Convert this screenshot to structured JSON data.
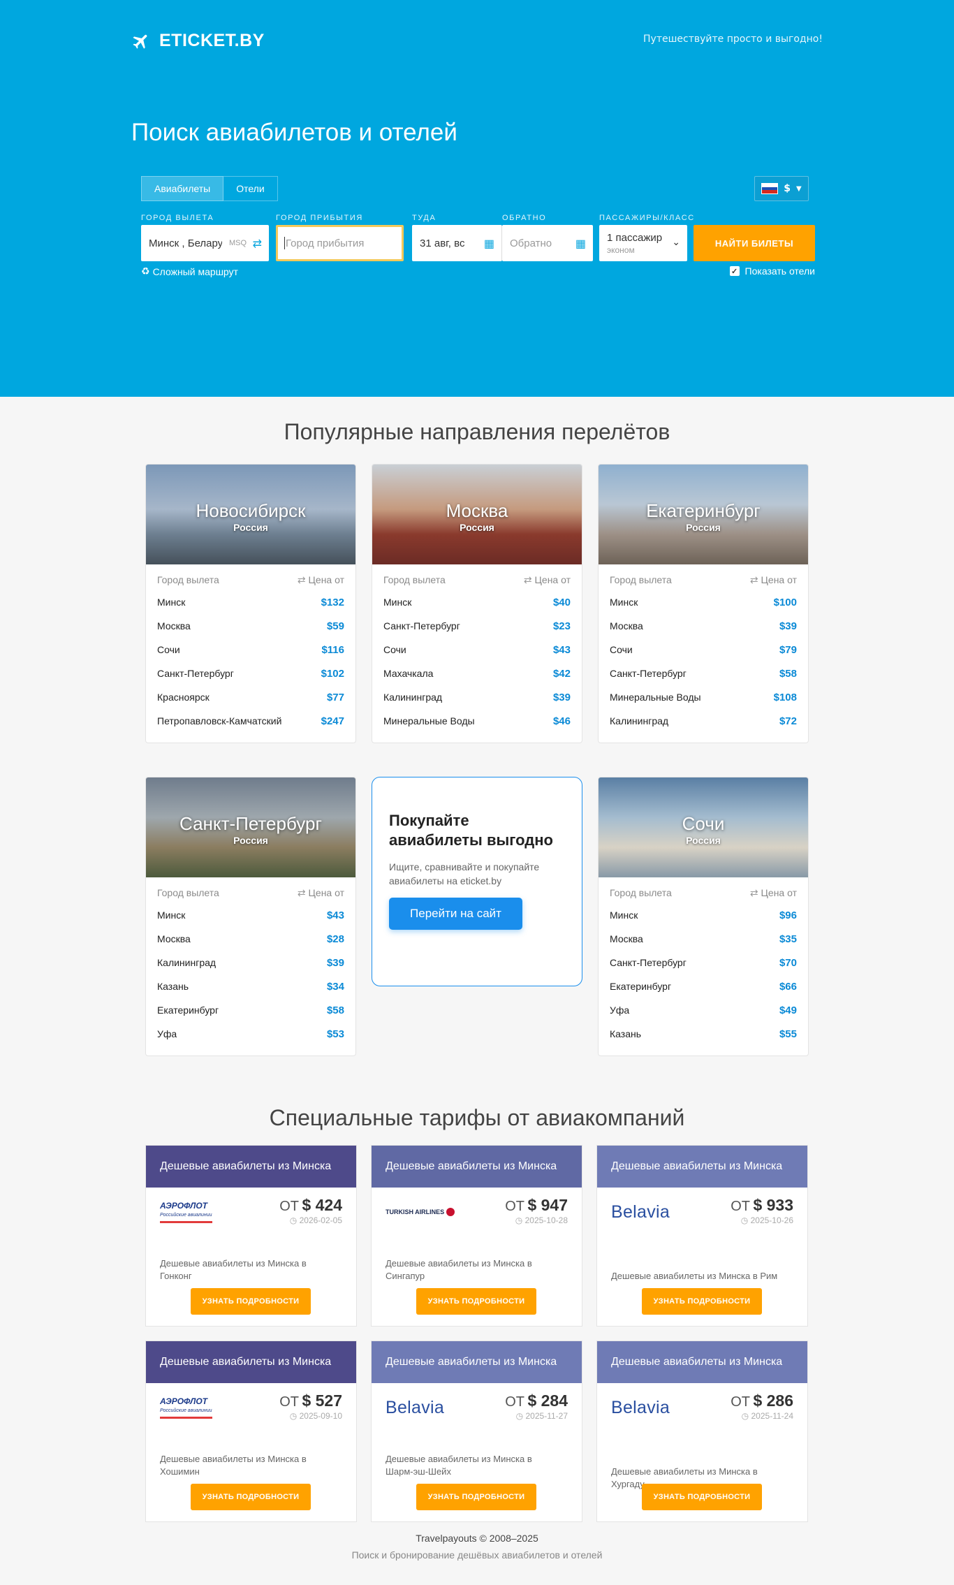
{
  "header": {
    "logo_text": "ETICKET.BY",
    "tagline": "Путешествуйте просто и выгодно!",
    "title": "Поиск авиабилетов и отелей"
  },
  "search": {
    "tabs": [
      "Авиабилеты",
      "Отели"
    ],
    "currency": "$",
    "labels": {
      "from": "ГОРОД ВЫЛЕТА",
      "to": "ГОРОД ПРИБЫТИЯ",
      "depart": "ТУДА",
      "return": "ОБРАТНО",
      "pax": "ПАССАЖИРЫ/КЛАСС"
    },
    "from_value": "Минск , Беларусь",
    "from_iata": "MSQ",
    "to_placeholder": "Город прибытия",
    "depart_value": "31 авг, вс",
    "return_placeholder": "Обратно",
    "pax_value": "1 пассажир",
    "pax_class": "эконом",
    "search_button": "НАЙТИ БИЛЕТЫ",
    "complex_route": "Сложный маршрут",
    "show_hotels": "Показать отели"
  },
  "popular": {
    "title": "Популярные направления перелётов",
    "col_from": "Город вылета",
    "col_price": "Цена от",
    "cards": [
      {
        "city": "Новосибирск",
        "country": "Россия",
        "rows": [
          [
            "Минск",
            "$132"
          ],
          [
            "Москва",
            "$59"
          ],
          [
            "Сочи",
            "$116"
          ],
          [
            "Санкт-Петербург",
            "$102"
          ],
          [
            "Красноярск",
            "$77"
          ],
          [
            "Петропавловск-Камчатский",
            "$247"
          ]
        ]
      },
      {
        "city": "Москва",
        "country": "Россия",
        "rows": [
          [
            "Минск",
            "$40"
          ],
          [
            "Санкт-Петербург",
            "$23"
          ],
          [
            "Сочи",
            "$43"
          ],
          [
            "Махачкала",
            "$42"
          ],
          [
            "Калининград",
            "$39"
          ],
          [
            "Минеральные Воды",
            "$46"
          ]
        ]
      },
      {
        "city": "Екатеринбург",
        "country": "Россия",
        "rows": [
          [
            "Минск",
            "$100"
          ],
          [
            "Москва",
            "$39"
          ],
          [
            "Сочи",
            "$79"
          ],
          [
            "Санкт-Петербург",
            "$58"
          ],
          [
            "Минеральные Воды",
            "$108"
          ],
          [
            "Калининград",
            "$72"
          ]
        ]
      },
      {
        "city": "Санкт-Петербург",
        "country": "Россия",
        "rows": [
          [
            "Минск",
            "$43"
          ],
          [
            "Москва",
            "$28"
          ],
          [
            "Калининград",
            "$39"
          ],
          [
            "Казань",
            "$34"
          ],
          [
            "Екатеринбург",
            "$58"
          ],
          [
            "Уфа",
            "$53"
          ]
        ]
      },
      {
        "city": "Сочи",
        "country": "Россия",
        "rows": [
          [
            "Минск",
            "$96"
          ],
          [
            "Москва",
            "$35"
          ],
          [
            "Санкт-Петербург",
            "$70"
          ],
          [
            "Екатеринбург",
            "$66"
          ],
          [
            "Уфа",
            "$49"
          ],
          [
            "Казань",
            "$55"
          ]
        ]
      }
    ],
    "promo": {
      "title": "Покупайте авиабилеты выгодно",
      "text": "Ищите, сравнивайте и покупайте авиабилеты на eticket.by",
      "button": "Перейти на сайт"
    }
  },
  "special": {
    "title": "Специальные тарифы от авиакомпаний",
    "header_text": "Дешевые авиабилеты из Минска",
    "from_word": "ОТ",
    "button": "УЗНАТЬ ПОДРОБНОСТИ",
    "aeroflot_name": "АЭРОФЛОТ",
    "aeroflot_sub": "Российские авиалинии",
    "turkish_name": "TURKISH AIRLINES",
    "belavia_name": "Belavia",
    "cards": [
      {
        "price": "$ 424",
        "date": "2026-02-05",
        "desc": "Дешевые авиабилеты из Минска в Гонконг"
      },
      {
        "price": "$ 947",
        "date": "2025-10-28",
        "desc": "Дешевые авиабилеты из Минска в Сингапур"
      },
      {
        "price": "$ 933",
        "date": "2025-10-26",
        "desc": "Дешевые авиабилеты из Минска в Рим"
      },
      {
        "price": "$ 527",
        "date": "2025-09-10",
        "desc": "Дешевые авиабилеты из Минска в Хошимин"
      },
      {
        "price": "$ 284",
        "date": "2025-11-27",
        "desc": "Дешевые авиабилеты из Минска в Шарм-эш-Шейх"
      },
      {
        "price": "$ 286",
        "date": "2025-11-24",
        "desc": "Дешевые авиабилеты из Минска в Хургаду"
      }
    ]
  },
  "footer": {
    "copyright": "Travelpayouts © 2008–2025",
    "sub": "Поиск и бронирование дешёвых авиабилетов и отелей"
  },
  "colors": {
    "hero_bg": "#00a7df",
    "accent_orange": "#ffa200",
    "link_blue": "#0b8ad6",
    "promo_blue": "#1a8eec"
  }
}
